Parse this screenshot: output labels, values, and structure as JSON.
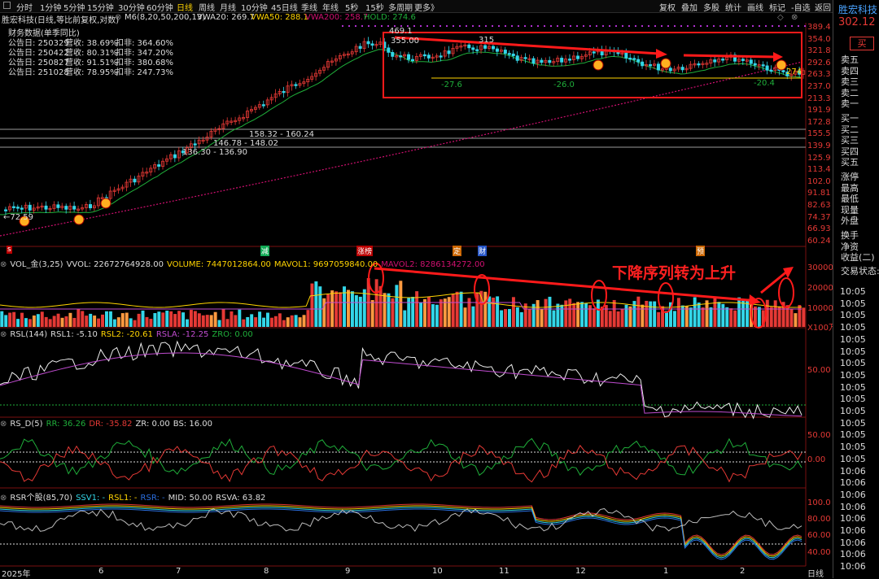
{
  "toolbar": {
    "timeframes": [
      "分时",
      "1分钟",
      "5分钟",
      "15分钟",
      "30分钟",
      "60分钟",
      "日线",
      "周线",
      "月线",
      "10分钟",
      "45日线",
      "季线",
      "年线",
      "5秒",
      "15秒",
      "多周期",
      "更多》"
    ],
    "active": "日线",
    "right": [
      "复权",
      "叠加",
      "多股",
      "统计",
      "画线",
      "标记",
      "-自选",
      "返回"
    ]
  },
  "header": {
    "stock_title": "胜宏科技(日线,等比前复权,对数)",
    "indicator": "M6(8,20,50,200,13)",
    "vwa20": "VWA20: 269.7",
    "vwa50": "VWA50: 288.1",
    "vwa200": "VWA200: 258.7",
    "hold": "HOLD: 274.6"
  },
  "financial": {
    "title": "财务数据(单季同比)",
    "rows": [
      {
        "label": "公告日: 250329",
        "rev": "营收: 38.69%",
        "np": "扣非: 364.60%"
      },
      {
        "label": "公告日: 250422",
        "rev": "营收: 80.31%",
        "np": "扣非: 347.20%"
      },
      {
        "label": "公告日: 250827",
        "rev": "营收: 91.51%",
        "np": "扣非: 380.68%"
      },
      {
        "label": "公告日: 251028",
        "rev": "营收: 78.95%",
        "np": "扣非: 247.73%"
      }
    ]
  },
  "price_axis": [
    "389.4",
    "354.0",
    "321.8",
    "292.6",
    "263.3",
    "237.0",
    "213.3",
    "191.9",
    "172.8",
    "155.5",
    "139.9",
    "125.9",
    "113.4",
    "102.0",
    "91.81",
    "82.63",
    "74.37",
    "66.93",
    "60.24"
  ],
  "price_annotations": {
    "high": "469.1",
    "mid_high": "355.00",
    "p315": "315",
    "low1": "-27.6",
    "low2": "-26.0",
    "low3": "-20.4",
    "last": "274",
    "range1": "158.32 - 160.24",
    "range2": "146.78 - 148.02",
    "range3": "136.30 - 136.90",
    "start_low": "←72.59"
  },
  "events": [
    "减",
    "涨榜",
    "定",
    "财",
    "预"
  ],
  "volume": {
    "title": "VOL_金(3,25)",
    "vvol": "VVOL: 22672764928.00",
    "volume": "VOLUME: 7447012864.00",
    "mavol1": "MAVOL1: 9697059840.00",
    "mavol2": "MAVOL2: 8286134272.00",
    "axis": [
      "30000",
      "20000",
      "10000"
    ],
    "unit": "X100万",
    "annotation": "下降序列转为上升"
  },
  "rsl": {
    "title": "RSL(144)",
    "rsl1": "RSL1: -5.10",
    "rsl2": "RSL2: -20.61",
    "rsla": "RSLA: -12.25",
    "zro": "ZRO: 0.00",
    "axis": "50.00"
  },
  "rsd": {
    "title": "RS_D(5)",
    "rr": "RR: 36.26",
    "dr": "DR: -35.82",
    "zr": "ZR: 0.00",
    "bs": "BS: 16.00",
    "axis": [
      "50.00",
      "0.00"
    ]
  },
  "rsr": {
    "title": "RSR个股(85,70)",
    "ssv1": "SSV1: -",
    "rsl1": "RSL1: -",
    "rsr": "RSR: -",
    "mid": "MID: 50.00",
    "rsva": "RSVA: 63.82",
    "axis": [
      "100.0",
      "80.00",
      "60.00",
      "40.00"
    ]
  },
  "xaxis": {
    "year": "2025年",
    "months": [
      "6",
      "7",
      "8",
      "9",
      "10",
      "11",
      "12",
      "1",
      "2"
    ],
    "period": "日线"
  },
  "sidebar": {
    "name": "胜宏科技",
    "price": "302.12",
    "buy_button": "买",
    "sell": [
      "卖五",
      "卖四",
      "卖三",
      "卖二",
      "卖一"
    ],
    "buy": [
      "买一",
      "买二",
      "买三",
      "买四",
      "买五"
    ],
    "stats": [
      "涨停",
      "最高",
      "最低",
      "现量",
      "外盘"
    ],
    "stats2": [
      "换手",
      "净资",
      "收益(二)"
    ],
    "ticks_title": "交易状态:",
    "ticks": [
      "10:05",
      "10:05",
      "10:05",
      "10:05",
      "10:05",
      "10:05",
      "10:05",
      "10:05",
      "10:05",
      "10:05",
      "10:05",
      "10:05",
      "10:05",
      "10:05",
      "10:05",
      "10:06",
      "10:06",
      "10:06",
      "10:06",
      "10:06",
      "10:06",
      "10:06",
      "10:06",
      "10:06",
      "10:06",
      "10:06",
      "10:06",
      "10:06",
      "10:06",
      "10:06",
      "10:06",
      "10:06",
      "10:06",
      "10:06"
    ]
  },
  "colors": {
    "up": "#e53935",
    "down": "#33d6e8",
    "ma": "#1fae3a",
    "ma200": "#d01070",
    "accent": "#ffd400",
    "rect": "#ff1a1a"
  }
}
